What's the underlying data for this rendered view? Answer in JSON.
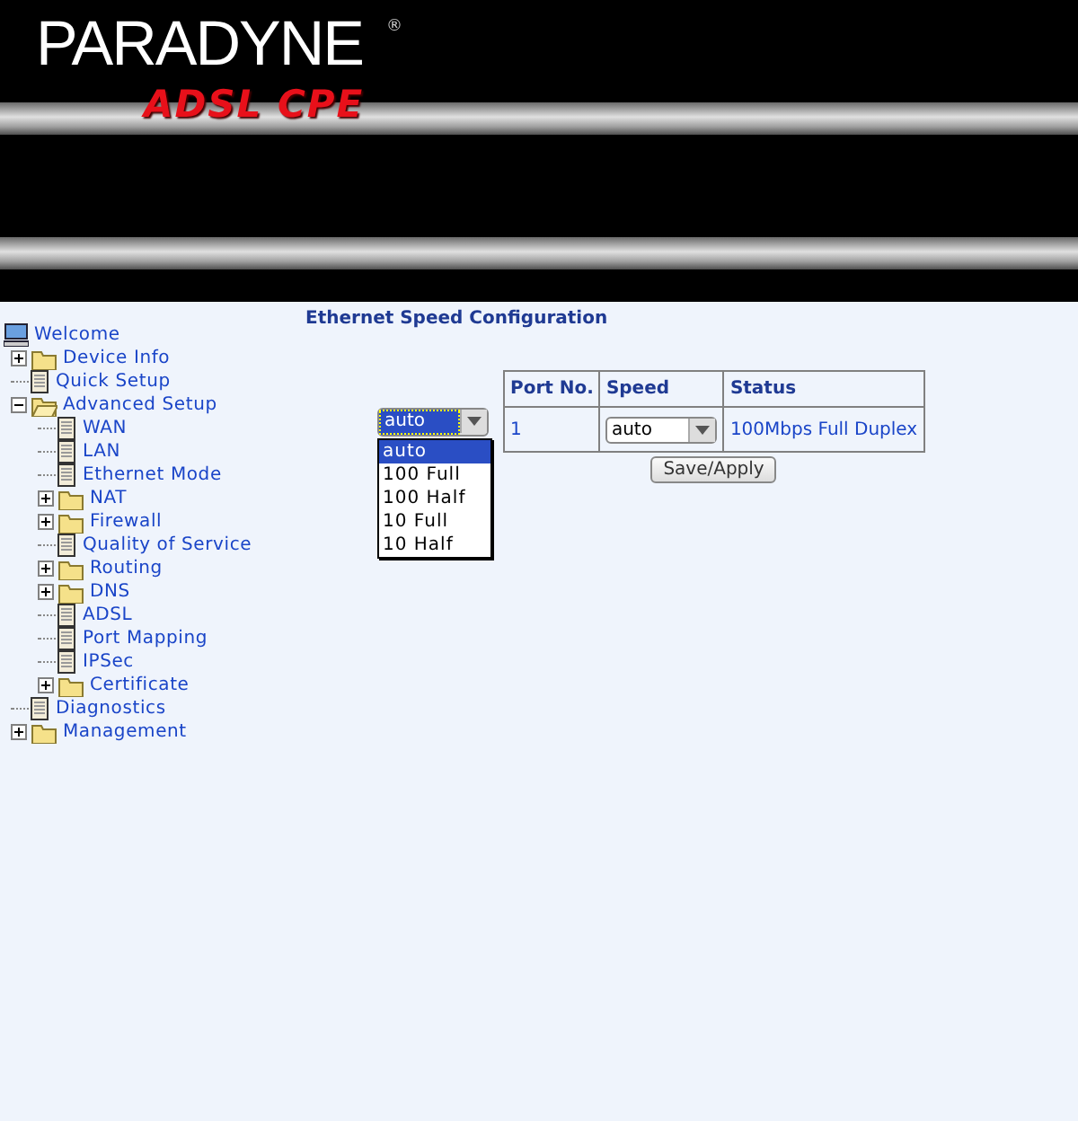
{
  "header": {
    "brand": "PARADYNE",
    "registered": "®",
    "product": "ADSL CPE"
  },
  "tree": {
    "label": "Welcome",
    "children": [
      {
        "label": "Device Info",
        "kind": "folder",
        "expanded": false
      },
      {
        "label": "Quick Setup",
        "kind": "page"
      },
      {
        "label": "Advanced Setup",
        "kind": "folder",
        "expanded": true,
        "children": [
          {
            "label": "WAN",
            "kind": "page"
          },
          {
            "label": "LAN",
            "kind": "page"
          },
          {
            "label": "Ethernet Mode",
            "kind": "page"
          },
          {
            "label": "NAT",
            "kind": "folder",
            "expanded": false
          },
          {
            "label": "Firewall",
            "kind": "folder",
            "expanded": false
          },
          {
            "label": "Quality of Service",
            "kind": "page"
          },
          {
            "label": "Routing",
            "kind": "folder",
            "expanded": false
          },
          {
            "label": "DNS",
            "kind": "folder",
            "expanded": false
          },
          {
            "label": "ADSL",
            "kind": "page"
          },
          {
            "label": "Port Mapping",
            "kind": "page"
          },
          {
            "label": "IPSec",
            "kind": "page"
          },
          {
            "label": "Certificate",
            "kind": "folder",
            "expanded": false
          }
        ]
      },
      {
        "label": "Diagnostics",
        "kind": "page"
      },
      {
        "label": "Management",
        "kind": "folder",
        "expanded": false
      }
    ]
  },
  "page_title": "Ethernet Speed Configuration",
  "dropdown": {
    "value": "auto",
    "options": [
      {
        "label": "auto",
        "selected": true
      },
      {
        "label": "100 Full",
        "selected": false
      },
      {
        "label": "100 Half",
        "selected": false
      },
      {
        "label": "10 Full",
        "selected": false
      },
      {
        "label": "10 Half",
        "selected": false
      }
    ]
  },
  "table": {
    "columns": [
      "Port No.",
      "Speed",
      "Status"
    ],
    "rows": [
      {
        "port": "1",
        "speed": "auto",
        "status": "100Mbps Full Duplex"
      }
    ]
  },
  "button": "Save/Apply"
}
